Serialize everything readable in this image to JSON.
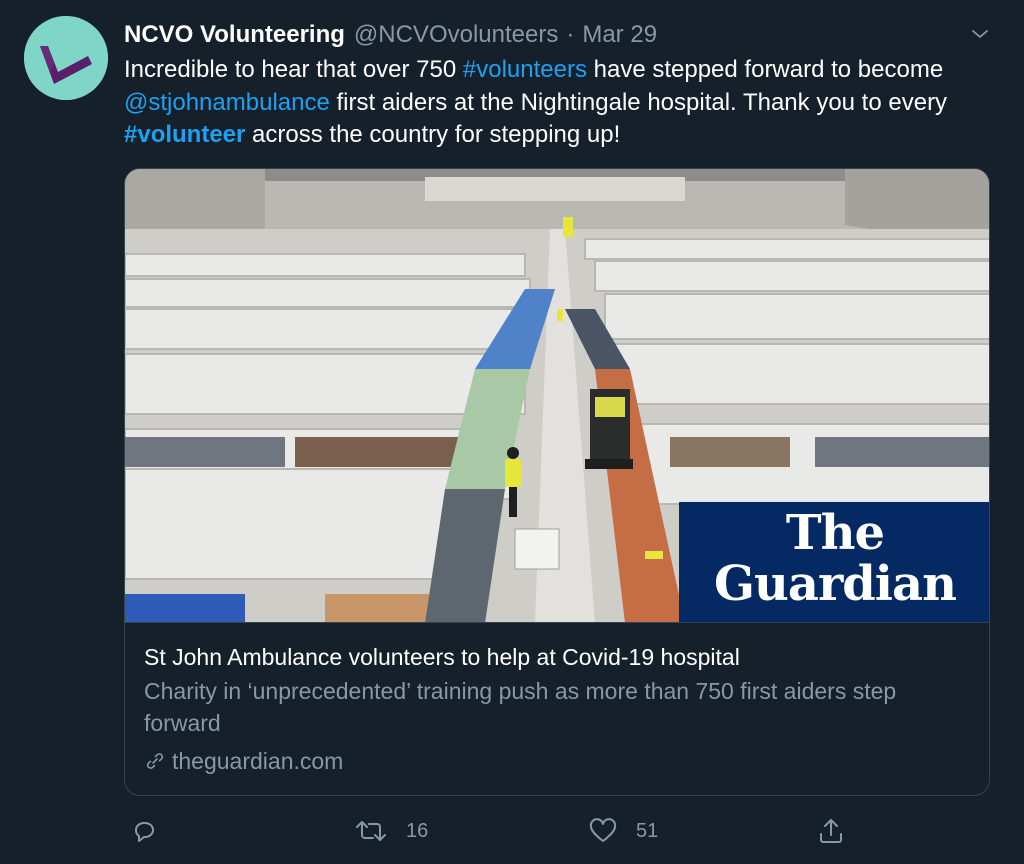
{
  "tweet": {
    "author": {
      "display_name": "NCVO Volunteering",
      "handle": "@NCVOvolunteers",
      "separator": "·",
      "date": "Mar 29"
    },
    "text": {
      "p1": "Incredible to hear that over 750 ",
      "hashtag1": "#volunteers",
      "p2": " have stepped forward to become ",
      "mention": "@stjohnambulance",
      "p3": " first aiders at the Nightingale hospital. Thank you to every ",
      "hashtag2": "#volunteer",
      "p4": " across the country for stepping up!"
    },
    "card": {
      "logo_line1": "The",
      "logo_line2": "Guardian",
      "title": "St John Ambulance volunteers to help at Covid-19 hospital",
      "description": "Charity in ‘unprecedented’ training push as more than 750 first aiders step forward",
      "domain": "theguardian.com",
      "domain_icon": "link-icon",
      "image_alt": "field-hospital-photo"
    },
    "actions": {
      "reply": {
        "icon": "reply-icon",
        "count": ""
      },
      "retweet": {
        "icon": "retweet-icon",
        "count": "16"
      },
      "like": {
        "icon": "heart-icon",
        "count": "51"
      },
      "share": {
        "icon": "share-icon",
        "count": ""
      }
    }
  },
  "colors": {
    "background": "#15202b",
    "link": "#1da1f2",
    "muted": "#8899a6",
    "border": "#38444d",
    "guardian_blue": "#052962",
    "avatar_bg": "#7fd6c6",
    "avatar_mark": "#5b1f6a"
  }
}
